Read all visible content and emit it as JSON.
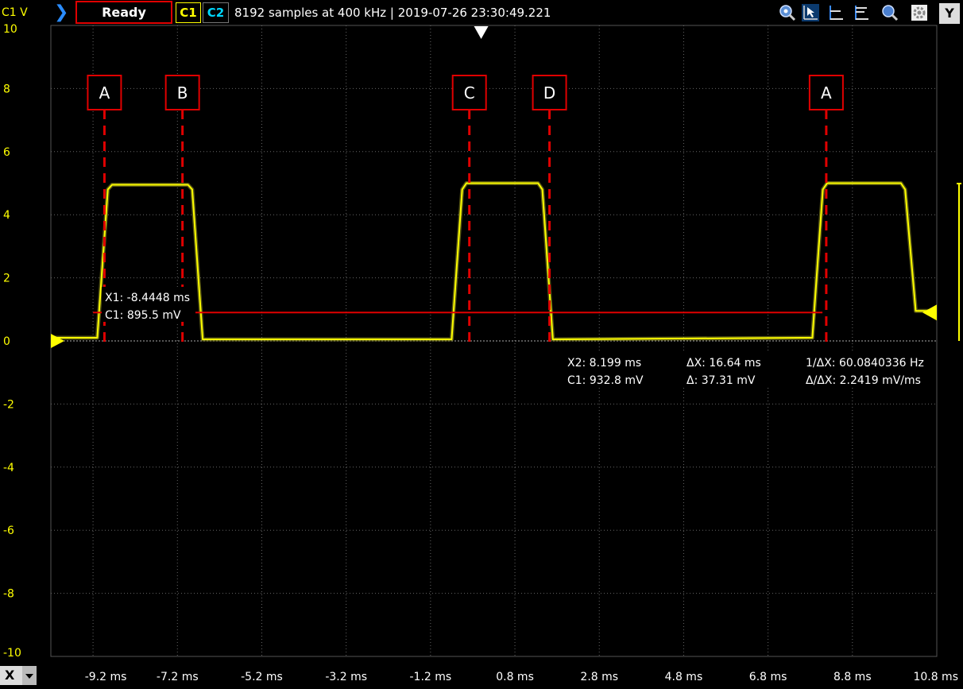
{
  "toolbar": {
    "channel_unit": "C1 V",
    "status": "Ready",
    "ch1": "C1",
    "ch2": "C2",
    "acquisition_info": "8192 samples at 400 kHz | 2019-07-26 23:30:49.221",
    "y_button": "Y"
  },
  "x_button": "X",
  "colors": {
    "trace": "#ffff00",
    "marker": "#e00000",
    "accent": "#2a8cff",
    "ch2": "#00d8ff"
  },
  "chart_data": {
    "type": "line",
    "ylabel": "C1 V",
    "xlim": [
      -10.2,
      10.8
    ],
    "ylim": [
      -10,
      10
    ],
    "grid": true,
    "y_ticks": [
      "10",
      "8",
      "6",
      "4",
      "2",
      "0",
      "-2",
      "-4",
      "-6",
      "-8",
      "-10"
    ],
    "x_ticks": [
      "-9.2 ms",
      "-7.2 ms",
      "-5.2 ms",
      "-3.2 ms",
      "-1.2 ms",
      "0.8 ms",
      "2.8 ms",
      "4.8 ms",
      "6.8 ms",
      "8.8 ms",
      "10.8 ms"
    ],
    "series": [
      {
        "x": [
          -10.2,
          -9.1,
          -8.85,
          -8.75,
          -6.95,
          -6.85,
          -6.6,
          -0.7,
          -0.45,
          -0.35,
          1.35,
          1.45,
          1.7,
          7.85,
          8.1,
          8.2,
          9.95,
          10.05,
          10.3,
          10.8
        ],
        "y": [
          0.1,
          0.1,
          4.8,
          4.95,
          4.95,
          4.8,
          0.05,
          0.05,
          4.8,
          5.0,
          5.0,
          4.8,
          0.05,
          0.1,
          4.8,
          5.0,
          5.0,
          4.8,
          0.95,
          0.95
        ]
      }
    ],
    "markers": [
      {
        "label": "A",
        "x": -8.93
      },
      {
        "label": "B",
        "x": -7.08
      },
      {
        "label": "C",
        "x": -0.28
      },
      {
        "label": "D",
        "x": 1.62
      },
      {
        "label": "A",
        "x": 8.18
      }
    ],
    "cursor1": {
      "x": -9.2,
      "y": 0.9,
      "x_end": 8.09,
      "line1": "X1: -8.4448 ms",
      "line2": "C1: 895.5 mV"
    },
    "cursor_readout": {
      "x2": "X2: 8.199 ms",
      "c1": "C1: 932.8 mV",
      "dx": "ΔX: 16.64 ms",
      "dy": "Δ: 37.31 mV",
      "inv_dx": "1/ΔX: 60.0840336 Hz",
      "slope": "Δ/ΔX: 2.2419 mV/ms"
    },
    "trigger_x": 0.0,
    "ground_y": 0,
    "trigger_level_y": 0.9
  }
}
